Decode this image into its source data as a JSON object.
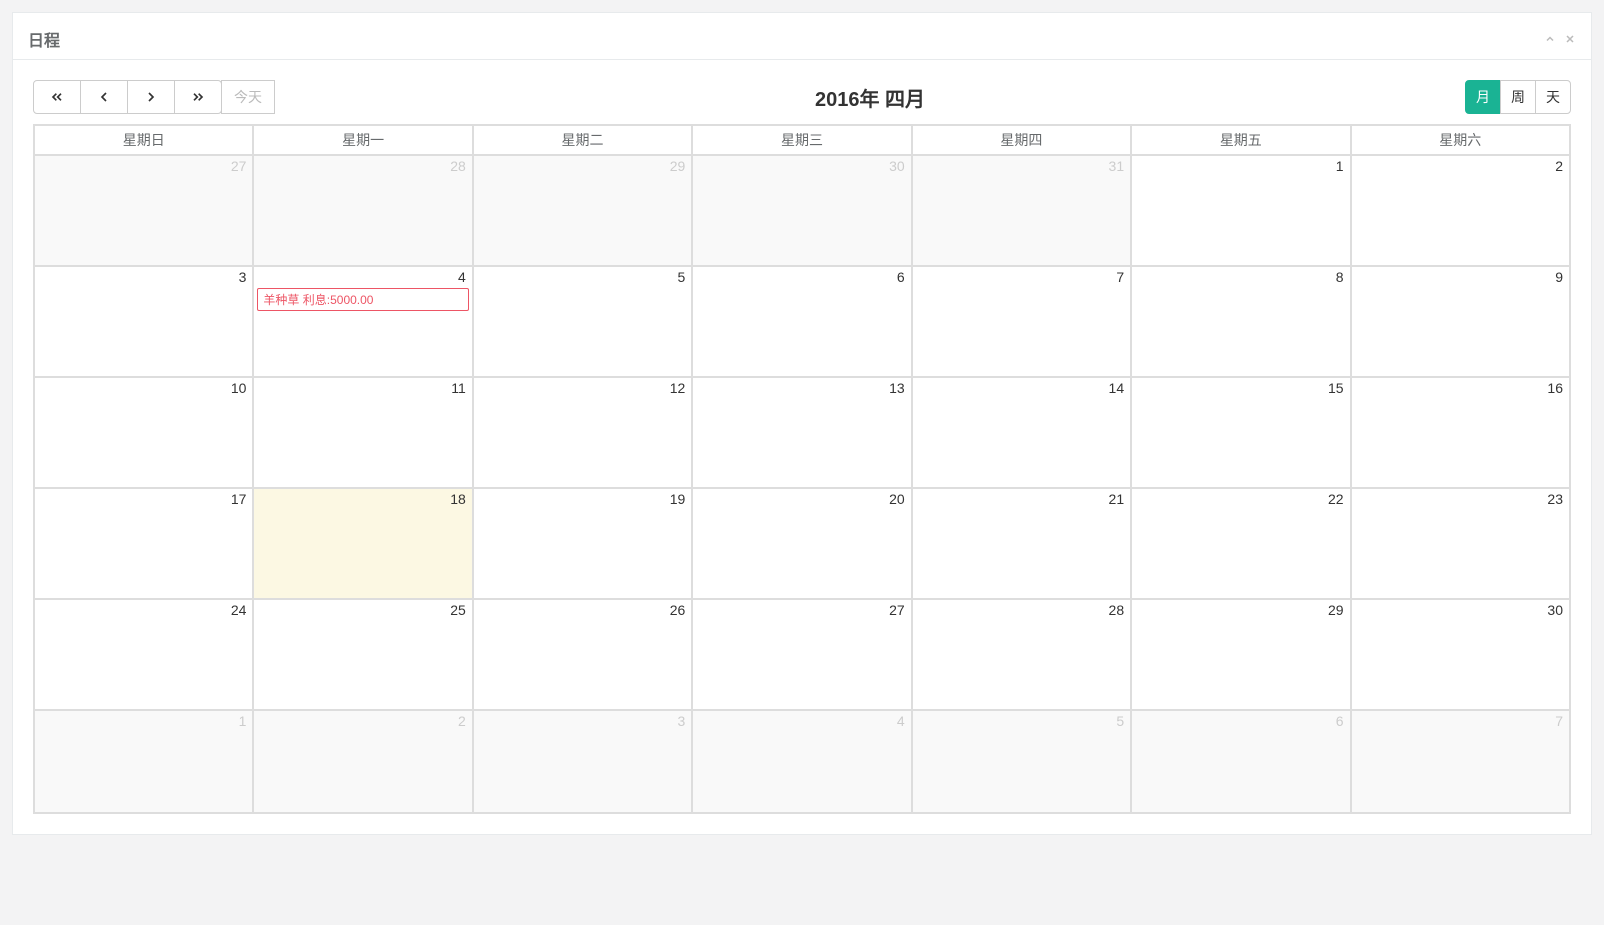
{
  "panel": {
    "title": "日程"
  },
  "toolbar": {
    "today_label": "今天",
    "title": "2016年 四月"
  },
  "views": {
    "month": "月",
    "week": "周",
    "day": "天"
  },
  "weekdays": [
    "星期日",
    "星期一",
    "星期二",
    "星期三",
    "星期四",
    "星期五",
    "星期六"
  ],
  "weeks": [
    {
      "days": [
        {
          "num": "27",
          "other": true
        },
        {
          "num": "28",
          "other": true
        },
        {
          "num": "29",
          "other": true
        },
        {
          "num": "30",
          "other": true
        },
        {
          "num": "31",
          "other": true
        },
        {
          "num": "1",
          "other": false
        },
        {
          "num": "2",
          "other": false
        }
      ]
    },
    {
      "days": [
        {
          "num": "3",
          "other": false
        },
        {
          "num": "4",
          "other": false,
          "events": [
            {
              "title": "羊种草 利息:5000.00"
            }
          ]
        },
        {
          "num": "5",
          "other": false
        },
        {
          "num": "6",
          "other": false
        },
        {
          "num": "7",
          "other": false
        },
        {
          "num": "8",
          "other": false
        },
        {
          "num": "9",
          "other": false
        }
      ]
    },
    {
      "days": [
        {
          "num": "10",
          "other": false
        },
        {
          "num": "11",
          "other": false
        },
        {
          "num": "12",
          "other": false
        },
        {
          "num": "13",
          "other": false
        },
        {
          "num": "14",
          "other": false
        },
        {
          "num": "15",
          "other": false
        },
        {
          "num": "16",
          "other": false
        }
      ]
    },
    {
      "days": [
        {
          "num": "17",
          "other": false
        },
        {
          "num": "18",
          "other": false,
          "today": true
        },
        {
          "num": "19",
          "other": false
        },
        {
          "num": "20",
          "other": false
        },
        {
          "num": "21",
          "other": false
        },
        {
          "num": "22",
          "other": false
        },
        {
          "num": "23",
          "other": false
        }
      ]
    },
    {
      "days": [
        {
          "num": "24",
          "other": false
        },
        {
          "num": "25",
          "other": false
        },
        {
          "num": "26",
          "other": false
        },
        {
          "num": "27",
          "other": false
        },
        {
          "num": "28",
          "other": false
        },
        {
          "num": "29",
          "other": false
        },
        {
          "num": "30",
          "other": false
        }
      ]
    },
    {
      "days": [
        {
          "num": "1",
          "other": true
        },
        {
          "num": "2",
          "other": true
        },
        {
          "num": "3",
          "other": true
        },
        {
          "num": "4",
          "other": true
        },
        {
          "num": "5",
          "other": true
        },
        {
          "num": "6",
          "other": true
        },
        {
          "num": "7",
          "other": true
        }
      ]
    }
  ]
}
